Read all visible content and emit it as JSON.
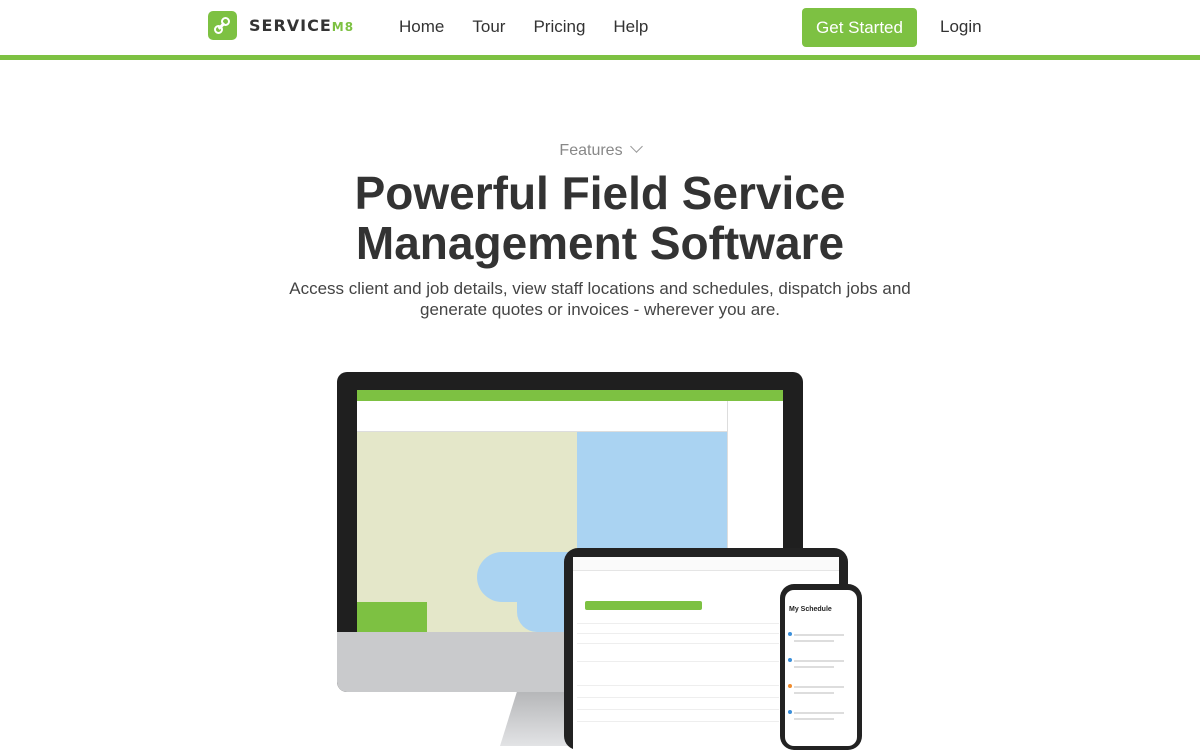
{
  "header": {
    "logo": {
      "text": "SERVICE",
      "suffix": "M8"
    },
    "nav": [
      {
        "label": "Home"
      },
      {
        "label": "Tour"
      },
      {
        "label": "Pricing"
      },
      {
        "label": "Help"
      }
    ],
    "cta_label": "Get Started",
    "login_label": "Login",
    "brand_color": "#7dc142"
  },
  "hero": {
    "eyebrow": "Features",
    "title_line1": "Powerful Field Service",
    "title_line2": "Management Software",
    "subtitle": "Access client and job details, view staff locations and schedules, dispatch jobs and generate quotes or invoices - wherever you are."
  },
  "devices": {
    "phone_heading": "My Schedule"
  },
  "icons": [
    "logo-icon",
    "chevron-down-icon"
  ]
}
